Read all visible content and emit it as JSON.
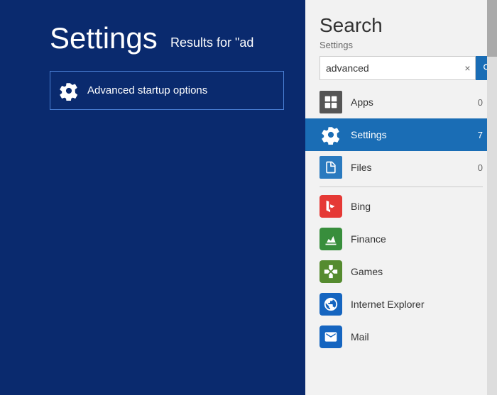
{
  "leftPanel": {
    "title": "Settings",
    "resultsFor": "Results for \"ad",
    "resultItem": {
      "label": "Advanced startup options"
    }
  },
  "rightPanel": {
    "search": {
      "title": "Search",
      "subtitle": "Settings",
      "inputValue": "advanced",
      "clearLabel": "×",
      "searchIconLabel": "search"
    },
    "categories": [
      {
        "id": "apps",
        "label": "Apps",
        "count": "0",
        "iconType": "apps",
        "active": false
      },
      {
        "id": "settings",
        "label": "Settings",
        "count": "7",
        "iconType": "settings",
        "active": true
      },
      {
        "id": "files",
        "label": "Files",
        "count": "0",
        "iconType": "files",
        "active": false
      }
    ],
    "apps": [
      {
        "id": "bing",
        "label": "Bing",
        "iconType": "bing"
      },
      {
        "id": "finance",
        "label": "Finance",
        "iconType": "finance"
      },
      {
        "id": "games",
        "label": "Games",
        "iconType": "games"
      },
      {
        "id": "ie",
        "label": "Internet Explorer",
        "iconType": "ie"
      },
      {
        "id": "mail",
        "label": "Mail",
        "iconType": "mail"
      }
    ]
  }
}
